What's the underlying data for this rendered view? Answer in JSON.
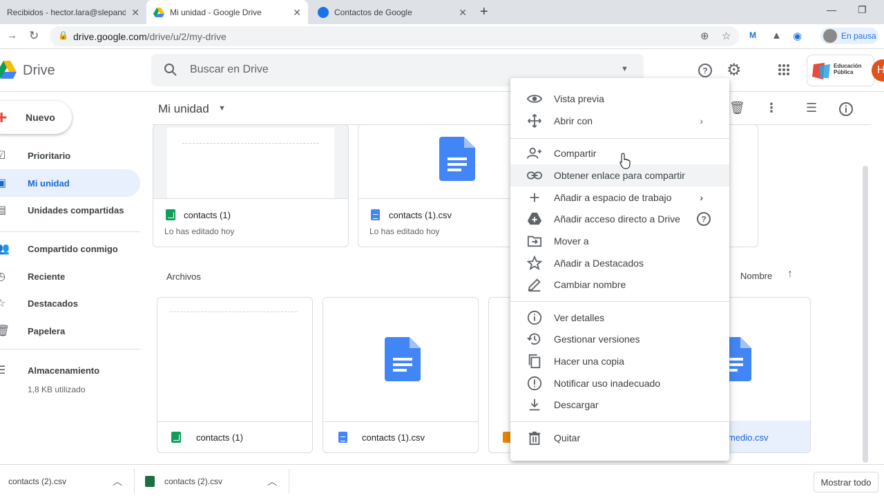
{
  "browser": {
    "tabs": [
      {
        "title": "Recibidos - hector.lara@slepand..."
      },
      {
        "title": "Mi unidad - Google Drive"
      },
      {
        "title": "Contactos de Google"
      }
    ],
    "url_host": "drive.google.com",
    "url_path": "/drive/u/2/my-drive",
    "profile_label": "En pausa"
  },
  "header": {
    "app_name": "Drive",
    "search_placeholder": "Buscar en Drive",
    "edu_logo_text": "Educación Pública",
    "avatar_letter": "H"
  },
  "sidebar": {
    "new_label": "Nuevo",
    "items": [
      {
        "label": "Prioritario"
      },
      {
        "label": "Mi unidad"
      },
      {
        "label": "Unidades compartidas"
      },
      {
        "label": "Compartido conmigo"
      },
      {
        "label": "Reciente"
      },
      {
        "label": "Destacados"
      },
      {
        "label": "Papelera"
      },
      {
        "label": "Almacenamiento"
      }
    ],
    "storage_used": "1,8 KB utilizado"
  },
  "main": {
    "breadcrumb": "Mi unidad",
    "section_files": "Archivos",
    "sort_label": "Nombre",
    "quick_access": [
      {
        "name": "contacts (1)",
        "sub": "Lo has editado hoy"
      },
      {
        "name": "contacts (1).csv",
        "sub": "Lo has editado hoy"
      }
    ],
    "files": [
      {
        "name": "contacts (1)"
      },
      {
        "name": "contacts (1).csv"
      },
      {
        "name": "medio.csv"
      }
    ]
  },
  "context_menu": {
    "items": [
      {
        "label": "Vista previa"
      },
      {
        "label": "Abrir con"
      },
      {
        "label": "Compartir"
      },
      {
        "label": "Obtener enlace para compartir"
      },
      {
        "label": "Añadir a espacio de trabajo"
      },
      {
        "label": "Añadir acceso directo a Drive"
      },
      {
        "label": "Mover a"
      },
      {
        "label": "Añadir a Destacados"
      },
      {
        "label": "Cambiar nombre"
      },
      {
        "label": "Ver detalles"
      },
      {
        "label": "Gestionar versiones"
      },
      {
        "label": "Hacer una copia"
      },
      {
        "label": "Notificar uso inadecuado"
      },
      {
        "label": "Descargar"
      },
      {
        "label": "Quitar"
      }
    ]
  },
  "downloads": {
    "items": [
      {
        "name": "contacts (2).csv"
      },
      {
        "name": "contacts (2).csv"
      }
    ],
    "show_all": "Mostrar todo"
  },
  "colors": {
    "accent": "#1a73e8",
    "active_nav_bg": "#e8f0fe",
    "sheets_green": "#0f9d58",
    "docs_blue": "#4285f4"
  }
}
